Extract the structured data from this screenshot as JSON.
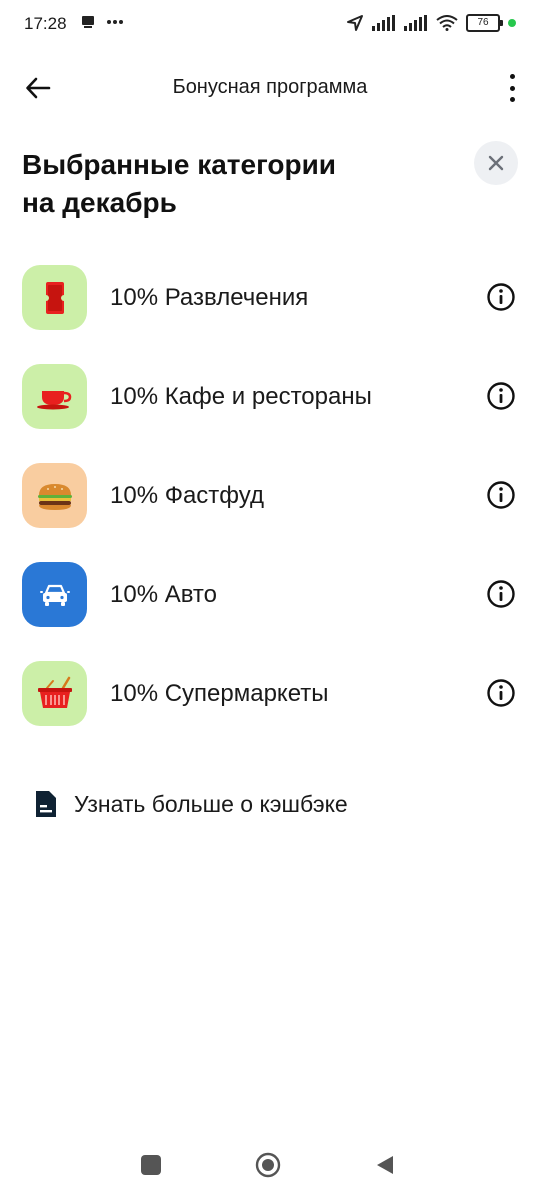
{
  "status_bar": {
    "time": "17:28",
    "battery": "76",
    "icons": [
      "notification-icon",
      "more-dots-icon",
      "location-icon",
      "signal-icon",
      "signal-icon",
      "wifi-icon",
      "battery-icon"
    ]
  },
  "app_bar": {
    "title": "Бонусная программа",
    "back_icon": "arrow-left-icon",
    "menu_icon": "more-vert-icon"
  },
  "heading": {
    "line1": "Выбранные категории",
    "line2": "на декабрь"
  },
  "categories": [
    {
      "label": "10% Развлечения",
      "icon": "ticket-icon",
      "bg": "#ccefa8"
    },
    {
      "label": "10% Кафе и рестораны",
      "icon": "cup-icon",
      "bg": "#ccefa8"
    },
    {
      "label": "10% Фастфуд",
      "icon": "burger-icon",
      "bg": "#f9cda0"
    },
    {
      "label": "10% Авто",
      "icon": "car-icon",
      "bg": "#2a78d6"
    },
    {
      "label": "10% Супермаркеты",
      "icon": "basket-icon",
      "bg": "#ccefa8"
    }
  ],
  "learn_more": {
    "label": "Узнать больше о кэшбэке",
    "icon": "document-icon"
  },
  "colors": {
    "green_bg": "#ccefa8",
    "orange_bg": "#f9cda0",
    "blue_bg": "#2a78d6",
    "close_bg": "#eef0f3"
  }
}
